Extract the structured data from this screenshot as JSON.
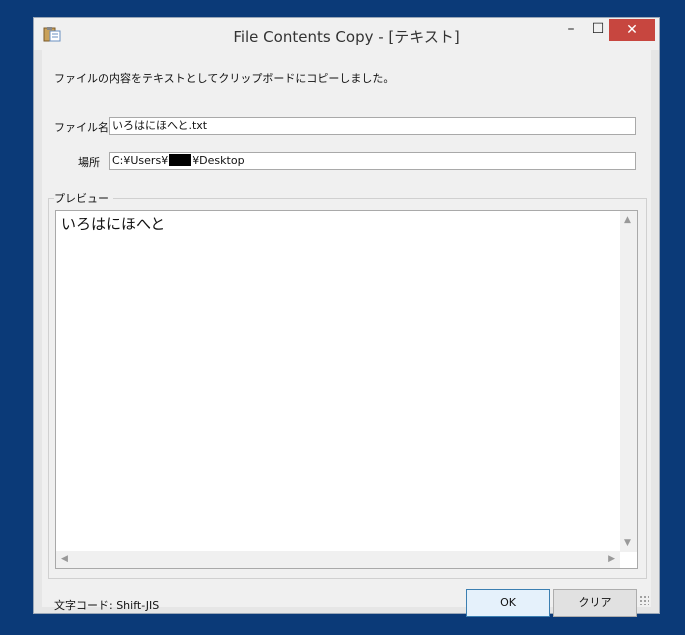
{
  "window": {
    "title": "File Contents Copy - [テキスト]",
    "minimize_glyph": "–",
    "maximize_glyph": "☐",
    "close_glyph": "✕"
  },
  "message": "ファイルの内容をテキストとしてクリップボードにコピーしました。",
  "filename": {
    "label": "ファイル名",
    "value": "いろはにほへと.txt"
  },
  "location": {
    "label": "場所",
    "value_prefix": "C:¥Users¥",
    "value_suffix": "¥Desktop"
  },
  "preview": {
    "label": "プレビュー",
    "content": "いろはにほへと"
  },
  "status": {
    "encoding": "文字コード: Shift-JIS"
  },
  "buttons": {
    "ok": "OK",
    "clear": "クリア"
  },
  "icons": {
    "app": "clipboard-icon",
    "scroll_up": "chevron-up-icon",
    "scroll_down": "chevron-down-icon",
    "scroll_left": "chevron-left-icon",
    "scroll_right": "chevron-right-icon"
  },
  "colors": {
    "desktop": "#0b3a78",
    "close_button": "#c7463f",
    "default_button_border": "#3c7fb1"
  }
}
